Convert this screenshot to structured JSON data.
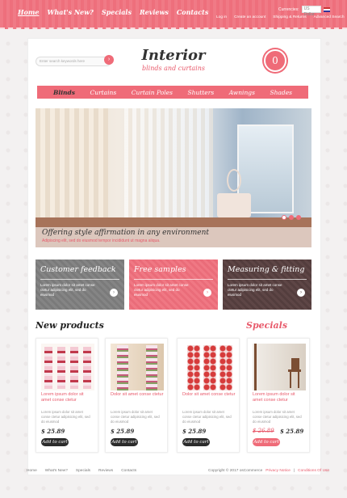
{
  "topnav": {
    "items": [
      "Home",
      "What's New?",
      "Specials",
      "Reviews",
      "Contacts"
    ]
  },
  "currency": {
    "label": "Currencies:",
    "selected": "US Dollar"
  },
  "toplinks": [
    "Log in",
    "Create an account",
    "Shipping & Returns",
    "Advanced Search"
  ],
  "search": {
    "placeholder": "Enter search keywords here"
  },
  "logo": {
    "title": "Interior",
    "subtitle": "blinds and curtains"
  },
  "cart": {
    "count": "0"
  },
  "menu": [
    "Blinds",
    "Curtains",
    "Curtain Poles",
    "Shutters",
    "Awnings",
    "Shades"
  ],
  "banner": {
    "title": "Offering style affirmation in any environment",
    "subtitle": "Adipiscing elit, sed do eiusmod tempor incididunt ut magna aliqua."
  },
  "features": [
    {
      "title": "Customer feedback",
      "text": "Lorem ipsum dolor sit amet conse ctetur adipisicing elit, sed do eiusmod"
    },
    {
      "title": "Free samples",
      "text": "Lorem ipsum dolor sit amet conse ctetur adipisicing elit, sed do eiusmod"
    },
    {
      "title": "Measuring & fitting",
      "text": "Lorem ipsum dolor sit amet conse ctetur adipisicing elit, sed do eiusmod"
    }
  ],
  "sections": {
    "new_products": "New products",
    "specials": "Specials"
  },
  "products": [
    {
      "name": "Lorem ipsum dolor sit amet conse ctetur",
      "desc": "Lorem ipsum dolor sit amet conse ctetur adipisicing elit, sed do eiusmod",
      "price": "$ 25.89",
      "button": "Add to cart"
    },
    {
      "name": "Dolor sit amet conse ctetur",
      "desc": "Lorem ipsum dolor sit amet conse ctetur adipisicing elit, sed do eiusmod",
      "price": "$ 25.89",
      "button": "Add to cart"
    },
    {
      "name": "Dolor sit amet conse ctetur",
      "desc": "Lorem ipsum dolor sit amet conse ctetur adipisicing elit, sed do eiusmod",
      "price": "$ 25.89",
      "button": "Add to cart"
    }
  ],
  "special": {
    "name": "Lorem ipsum dolor sit amet conse ctetur",
    "desc": "Lorem ipsum dolor sit amet conse ctetur adipisicing elit, sed do eiusmod",
    "old_price": "$ 26.89",
    "new_price": "$ 25.89",
    "button": "Add to cart"
  },
  "footer": {
    "links": [
      "Home",
      "What's New?",
      "Specials",
      "Reviews",
      "Contacts"
    ],
    "copyright": "Copyright © 2017 osCommerce",
    "privacy": "Privacy Notice",
    "conditions": "Conditions Of Use"
  },
  "colors": {
    "accent": "#ef6b78",
    "dark": "#2b2b2b",
    "grey": "#7a7a7a",
    "brown": "#533d3d"
  }
}
